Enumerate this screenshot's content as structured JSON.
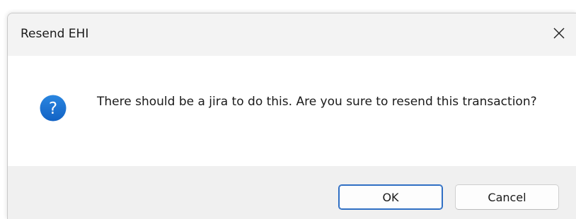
{
  "dialog": {
    "title": "Resend EHI",
    "message": "There should be a jira to do this. Are you sure to resend this transaction?",
    "icon": "question-icon",
    "close_icon": "close-icon"
  },
  "buttons": {
    "ok_label": "OK",
    "cancel_label": "Cancel"
  },
  "colors": {
    "icon_blue": "#1a6fd1",
    "default_button_border": "#2f6fc4"
  }
}
